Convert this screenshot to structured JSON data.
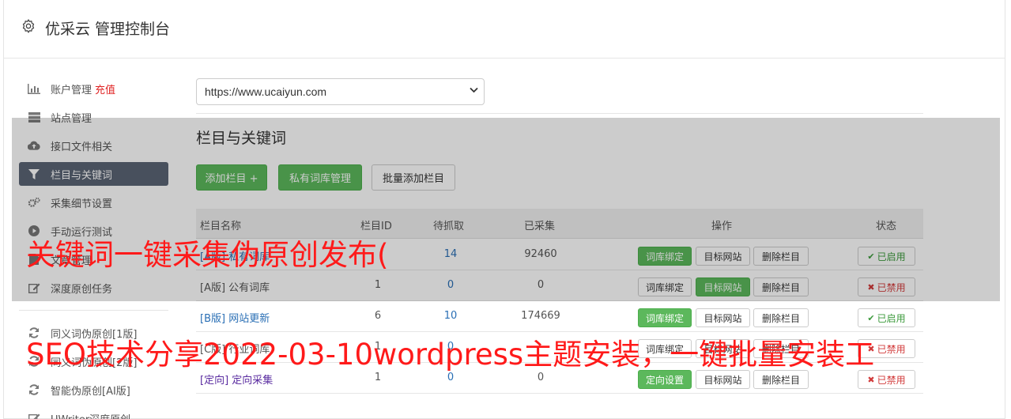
{
  "header": {
    "title": "优采云 管理控制台",
    "icon": "gear-icon"
  },
  "sidebar": {
    "items": [
      {
        "label": "账户管理",
        "icon": "bar-chart-icon",
        "extra": "充值"
      },
      {
        "label": "站点管理",
        "icon": "server-icon"
      },
      {
        "label": "接口文件相关",
        "icon": "cloud-upload-icon"
      },
      {
        "label": "栏目与关键词",
        "icon": "filter-icon",
        "active": true
      },
      {
        "label": "采集细节设置",
        "icon": "gears-icon"
      },
      {
        "label": "手动运行测试",
        "icon": "play-icon"
      },
      {
        "label": "文章管理",
        "icon": "file-icon"
      },
      {
        "label": "深度原创任务",
        "icon": "edit-icon"
      },
      {
        "label": "同义词伪原创[1版]",
        "icon": "refresh-icon"
      },
      {
        "label": "同义词伪原创[2版]",
        "icon": "refresh-icon"
      },
      {
        "label": "智能伪原创[AI版]",
        "icon": "refresh-icon"
      },
      {
        "label": "UWriter深度原创",
        "icon": "edit-icon"
      }
    ]
  },
  "site_select": {
    "value": "https://www.ucaiyun.com"
  },
  "section": {
    "title": "栏目与关键词"
  },
  "toolbar": {
    "add_column": "添加栏目 +",
    "private_lib": "私有词库管理",
    "batch_add": "批量添加栏目"
  },
  "table": {
    "headers": [
      "栏目名称",
      "栏目ID",
      "待抓取",
      "已采集",
      "操作",
      "状态"
    ],
    "rows": [
      {
        "name": "[A版] 私有词库",
        "id": "",
        "pending": "14",
        "collected": "92460",
        "op1": "词库绑定",
        "op2": "目标网站",
        "op3": "删除栏目",
        "status": "已启用",
        "enabled": true
      },
      {
        "name": "[A版] 公有词库",
        "id": "1",
        "pending": "0",
        "collected": "0",
        "op1": "词库绑定",
        "op2": "目标网站",
        "op3": "删除栏目",
        "status": "已禁用",
        "enabled": false
      },
      {
        "name": "[B版] 网站更新",
        "id": "6",
        "pending": "10",
        "collected": "174669",
        "op1": "词库绑定",
        "op2": "目标网站",
        "op3": "删除栏目",
        "status": "已启用",
        "enabled": true
      },
      {
        "name": "[C版] 行业词库",
        "id": "1",
        "pending": "0",
        "collected": "",
        "op1": "词库绑定",
        "op2": "目标网站",
        "op3": "删除栏目",
        "status": "已禁用",
        "enabled": false
      },
      {
        "name": "[定向] 定向采集",
        "id": "1",
        "pending": "0",
        "collected": "0",
        "op1": "定向设置",
        "op2": "目标网站",
        "op3": "删除栏目",
        "status": "已禁用",
        "enabled": false
      }
    ]
  },
  "watermark": {
    "line1": "关键词一键采集伪原创发布(",
    "line2": "SEO技术分享2022-03-10wordpress主题安装，一键批量安装工"
  },
  "colors": {
    "accent_green": "#5cb85c",
    "active_sidebar": "#5b6475",
    "watermark_red": "#ff1a1a",
    "link_blue": "#2a6fb5"
  }
}
